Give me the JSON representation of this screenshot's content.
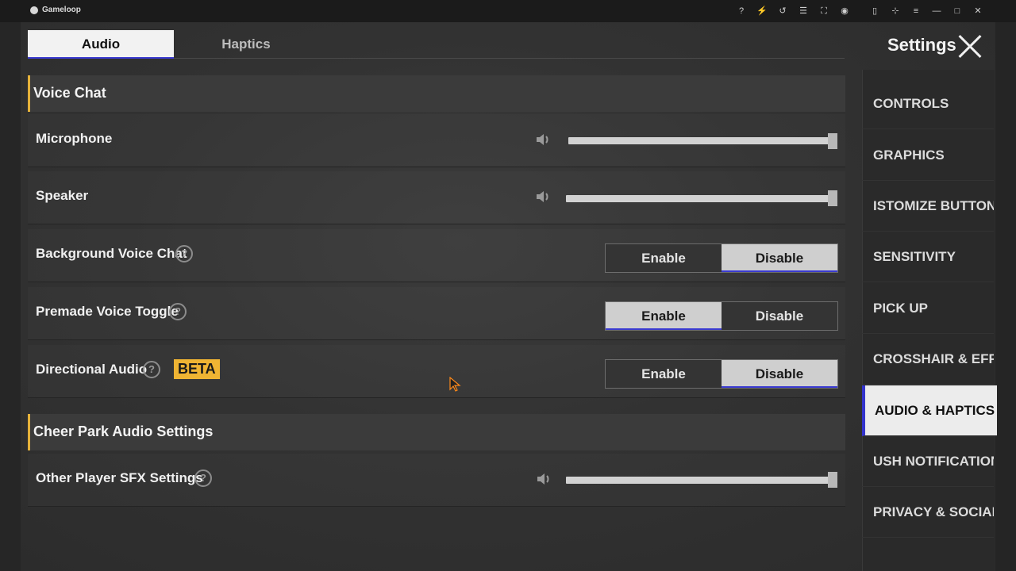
{
  "window": {
    "title": "Gameloop"
  },
  "titlebar_icons": [
    "help-icon",
    "bolt-icon",
    "undo-icon",
    "menu-grid-icon",
    "fullscreen-icon",
    "gamepad-icon",
    "sidebar-icon",
    "pin-icon",
    "menu-icon",
    "minimize-icon",
    "maximize-icon",
    "close-icon"
  ],
  "tabs": [
    {
      "label": "Audio",
      "active": true
    },
    {
      "label": "Haptics",
      "active": false
    }
  ],
  "sections": {
    "voice_chat": "Voice Chat",
    "cheer_park": "Cheer Park Audio Settings"
  },
  "rows": {
    "microphone": {
      "label": "Microphone",
      "level": 1.0
    },
    "speaker": {
      "label": "Speaker",
      "level": 1.0
    },
    "background_voice_chat": {
      "label": "Background Voice Chat",
      "enable": "Enable",
      "disable": "Disable",
      "selected": "Disable"
    },
    "premade_voice_toggle": {
      "label": "Premade Voice Toggle",
      "enable": "Enable",
      "disable": "Disable",
      "selected": "Enable"
    },
    "directional_audio": {
      "label": "Directional Audio",
      "badge": "BETA",
      "enable": "Enable",
      "disable": "Disable",
      "selected": "Disable"
    },
    "other_player_sfx": {
      "label": "Other Player SFX Settings",
      "level": 1.0
    }
  },
  "help_glyph": "?",
  "settings": {
    "title": "Settings",
    "nav": [
      {
        "label": "CONTROLS"
      },
      {
        "label": "GRAPHICS"
      },
      {
        "label": "ISTOMIZE BUTTONS"
      },
      {
        "label": "SENSITIVITY"
      },
      {
        "label": "PICK UP"
      },
      {
        "label": "CROSSHAIR & EFFE"
      },
      {
        "label": "AUDIO & HAPTICS",
        "active": true
      },
      {
        "label": "USH NOTIFICATIONS"
      },
      {
        "label": "PRIVACY & SOCIAL"
      }
    ]
  },
  "colors": {
    "accent_gold": "#e5b23a",
    "selected_underline": "#3a3ad0",
    "beta_badge": "#efb433"
  }
}
